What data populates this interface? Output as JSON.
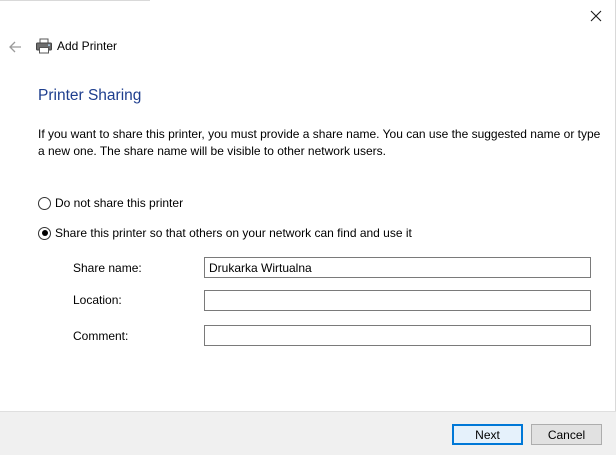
{
  "window": {
    "title": "Add Printer",
    "close_icon": "close-icon",
    "back_icon": "back-arrow-icon",
    "title_icon": "printer-icon"
  },
  "page": {
    "heading": "Printer Sharing",
    "description": "If you want to share this printer, you must provide a share name. You can use the suggested name or type a new one. The share name will be visible to other network users."
  },
  "sharing_options": {
    "do_not_share": {
      "label": "Do not share this printer",
      "selected": false
    },
    "share": {
      "label": "Share this printer so that others on your network can find and use it",
      "selected": true
    }
  },
  "fields": {
    "share_name": {
      "label": "Share name:",
      "value": "Drukarka Wirtualna"
    },
    "location": {
      "label": "Location:",
      "value": ""
    },
    "comment": {
      "label": "Comment:",
      "value": ""
    }
  },
  "buttons": {
    "next": "Next",
    "cancel": "Cancel"
  },
  "colors": {
    "heading": "#1e3e8e",
    "focus_border": "#0078d7",
    "footer_bg": "#f0f0f0"
  }
}
